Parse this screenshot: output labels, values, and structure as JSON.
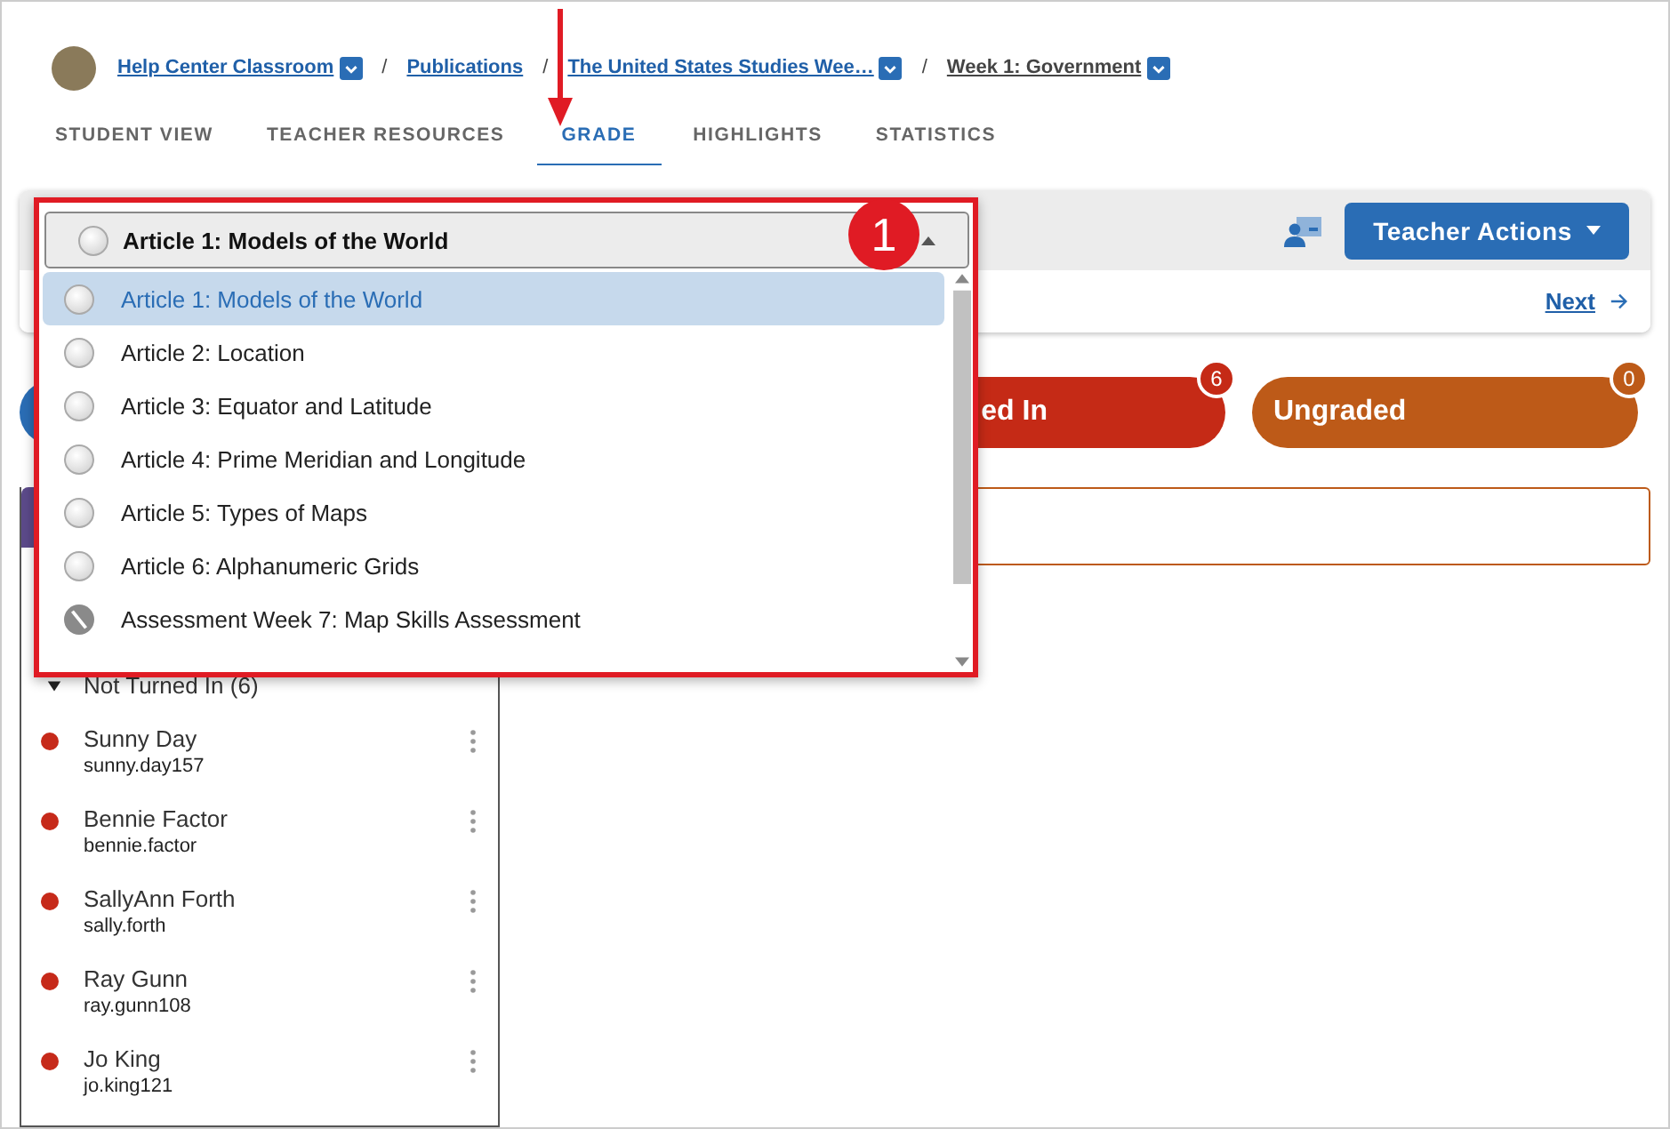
{
  "breadcrumbs": [
    {
      "label": "Help Center Classroom",
      "dropdown": true
    },
    {
      "label": "Publications",
      "dropdown": false
    },
    {
      "label": "The United States Studies Wee…",
      "dropdown": true
    },
    {
      "label": "Week 1: Government",
      "dropdown": true
    }
  ],
  "breadcrumb_separator": "/",
  "tabs": [
    {
      "label": "STUDENT VIEW",
      "selected": false
    },
    {
      "label": "TEACHER RESOURCES",
      "selected": false
    },
    {
      "label": "GRADE",
      "selected": true
    },
    {
      "label": "HIGHLIGHTS",
      "selected": false
    },
    {
      "label": "STATISTICS",
      "selected": false
    }
  ],
  "toolbar": {
    "teacher_actions": "Teacher Actions",
    "next": "Next"
  },
  "status_pills": [
    {
      "label": "ed In",
      "count": "6",
      "color": "#c52a16"
    },
    {
      "label": "Ungraded",
      "count": "0",
      "color": "#bd5a18"
    }
  ],
  "assignment_dropdown": {
    "value": "Article 1: Models of the World",
    "expanded": true,
    "options": [
      {
        "label": "Article 1: Models of the World",
        "kind": "article",
        "selected": true
      },
      {
        "label": "Article 2: Location",
        "kind": "article",
        "selected": false
      },
      {
        "label": "Article 3: Equator and Latitude",
        "kind": "article",
        "selected": false
      },
      {
        "label": "Article 4: Prime Meridian and Longitude",
        "kind": "article",
        "selected": false
      },
      {
        "label": "Article 5: Types of Maps",
        "kind": "article",
        "selected": false
      },
      {
        "label": "Article 6: Alphanumeric Grids",
        "kind": "article",
        "selected": false
      },
      {
        "label": "Assessment Week 7: Map Skills Assessment",
        "kind": "assessment",
        "selected": false
      }
    ]
  },
  "annotation": {
    "number": "1"
  },
  "student_group": {
    "label": "Not Turned In (6)",
    "expanded": true,
    "students": [
      {
        "name": "Sunny Day",
        "username": "sunny.day157",
        "color": "#c62a1a"
      },
      {
        "name": "Bennie Factor",
        "username": "bennie.factor",
        "color": "#c62a1a"
      },
      {
        "name": "SallyAnn Forth",
        "username": "sally.forth",
        "color": "#c62a1a"
      },
      {
        "name": "Ray Gunn",
        "username": "ray.gunn108",
        "color": "#c62a1a"
      },
      {
        "name": "Jo King",
        "username": "jo.king121",
        "color": "#c62a1a"
      }
    ]
  }
}
